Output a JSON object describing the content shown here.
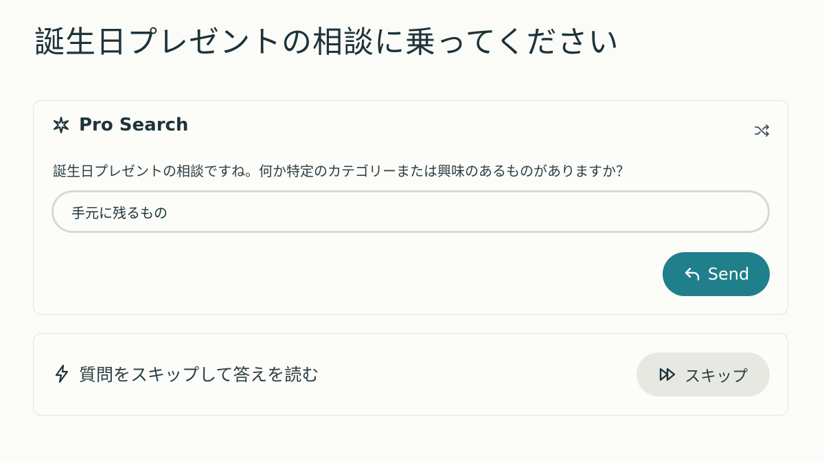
{
  "page": {
    "title": "誕生日プレゼントの相談に乗ってください"
  },
  "pro_search": {
    "title": "Pro Search",
    "title_icon": "sparkle-icon",
    "shuffle_icon": "shuffle-icon",
    "question": "誕生日プレゼントの相談ですね。何か特定のカテゴリーまたは興味のあるものがありますか？",
    "answer_value": "手元に残るもの",
    "send_label": "Send",
    "send_icon": "reply-icon"
  },
  "skip": {
    "label": "質問をスキップして答えを読む",
    "label_icon": "lightning-icon",
    "button_label": "スキップ",
    "button_icon": "fast-forward-icon"
  },
  "colors": {
    "background": "#fbfbf8",
    "accent": "#1f7f8a",
    "text": "#1c3339",
    "card_border": "#e3e3de",
    "skip_button_bg": "#e8e8e3"
  }
}
